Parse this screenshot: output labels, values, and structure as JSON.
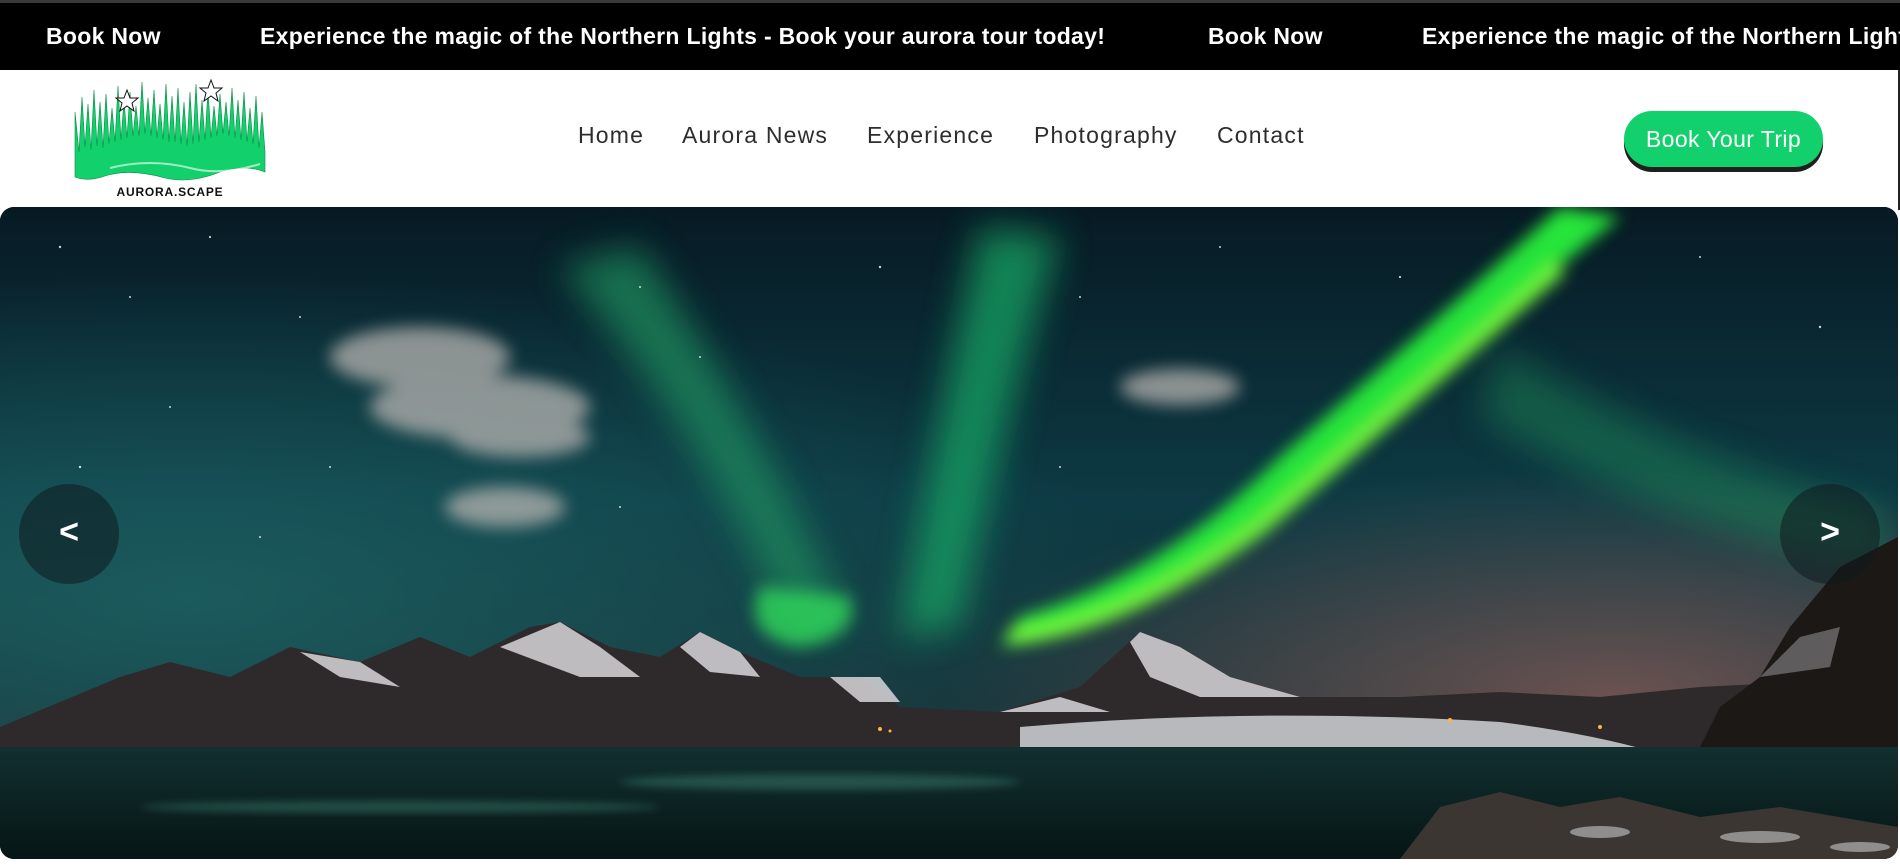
{
  "ticker": {
    "items": [
      "Book Now",
      "Experience the magic of the Northern Lights - Book your aurora tour today!",
      "Book Now",
      "Experience the magic of the Northern Lights - Book your aurora tour today!"
    ]
  },
  "brand": {
    "logo_text": "AURORA.SCAPE",
    "logo_icon": "aurora-logo-icon",
    "accent": "#12d16c"
  },
  "nav": {
    "items": [
      "Home",
      "Aurora News",
      "Experience",
      "Photography",
      "Contact"
    ]
  },
  "cta": {
    "label": "Book Your Trip"
  },
  "hero": {
    "prev_label": "<",
    "next_label": ">",
    "image_alt": "aurora-landscape-image"
  }
}
